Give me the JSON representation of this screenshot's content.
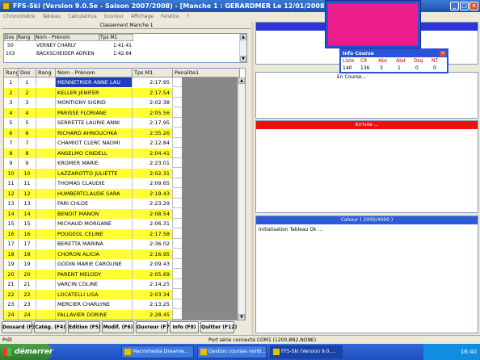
{
  "window": {
    "title": "FFS-Ski (Version 9.0.5e - Saison 2007/2008) - [Manche 1 : GERARDMER Le 12/01/2008 : FOND/KO-QLF]"
  },
  "menu": [
    "Chronométre",
    "Tableau",
    "Calculatrice",
    "Ouvreur",
    "Affichage",
    "Fenêtre",
    "?"
  ],
  "classement": {
    "title": "Classement Manche 1",
    "headers": [
      "Dos",
      "Rang",
      "Nom - Prénom",
      "Tps M1"
    ],
    "rows": [
      {
        "dos": "50",
        "rang": "",
        "nom": "VERNEY CHARLY",
        "tps": "1:41.41"
      },
      {
        "dos": "103",
        "rang": "",
        "nom": "BACKSCHEIDER ADRIEN",
        "tps": "1:42.64"
      }
    ]
  },
  "grid": {
    "headers": [
      "Rang",
      "Dos",
      "Rang",
      "Nom - Prénom",
      "Tps M1",
      "Penalite1"
    ],
    "rows": [
      {
        "rang": "1",
        "dos": "1",
        "nom": "MENNETRIER ANNE LAU",
        "tps": "2:17.95"
      },
      {
        "rang": "2",
        "dos": "2",
        "nom": "KELLER JENIFER",
        "tps": "2:17.54"
      },
      {
        "rang": "3",
        "dos": "3",
        "nom": "MONTIGNY SIGRID",
        "tps": "2:02.38"
      },
      {
        "rang": "4",
        "dos": "4",
        "nom": "PARISSE FLORIANE",
        "tps": "2:05.56"
      },
      {
        "rang": "5",
        "dos": "5",
        "nom": "SERRETTE LAURIE ANNI",
        "tps": "2:17.95"
      },
      {
        "rang": "6",
        "dos": "6",
        "nom": "RICHARD AHNOUCHKA",
        "tps": "2:35.26"
      },
      {
        "rang": "7",
        "dos": "7",
        "nom": "CHAMIOT CLERC NAOMI",
        "tps": "2:12.84"
      },
      {
        "rang": "8",
        "dos": "8",
        "nom": "ANSELMO CINDELL",
        "tps": "2:04.41"
      },
      {
        "rang": "9",
        "dos": "9",
        "nom": "KROMER MARIE",
        "tps": "2:23.01"
      },
      {
        "rang": "10",
        "dos": "10",
        "nom": "LAZZAROTTO JULIETTE",
        "tps": "2:02.31"
      },
      {
        "rang": "11",
        "dos": "11",
        "nom": "THOMAS CLAUDIE",
        "tps": "2:09.65"
      },
      {
        "rang": "12",
        "dos": "12",
        "nom": "HUMBERTCLAUDE SARA",
        "tps": "2:19.43"
      },
      {
        "rang": "13",
        "dos": "13",
        "nom": "FARI CHLOE",
        "tps": "2:23.29"
      },
      {
        "rang": "14",
        "dos": "14",
        "nom": "BENOIT MANON",
        "tps": "2:08.54"
      },
      {
        "rang": "15",
        "dos": "15",
        "nom": "MICHAUD MORGANE",
        "tps": "2:06.31"
      },
      {
        "rang": "16",
        "dos": "16",
        "nom": "POUGEOL CELINE",
        "tps": "2:17.58"
      },
      {
        "rang": "17",
        "dos": "17",
        "nom": "BERETTA MARINA",
        "tps": "2:36.02"
      },
      {
        "rang": "18",
        "dos": "18",
        "nom": "CHORON ALICIA",
        "tps": "2:16.95"
      },
      {
        "rang": "19",
        "dos": "19",
        "nom": "GODIN MARIE CAROLINE",
        "tps": "2:09.43"
      },
      {
        "rang": "20",
        "dos": "20",
        "nom": "PARENT MELODY",
        "tps": "2:05.69"
      },
      {
        "rang": "21",
        "dos": "21",
        "nom": "VARCIN COLINE",
        "tps": "2:14.25"
      },
      {
        "rang": "22",
        "dos": "22",
        "nom": "LOCATELLI LISA",
        "tps": "2:03.34"
      },
      {
        "rang": "23",
        "dos": "23",
        "nom": "MERCIER CHARLYNE",
        "tps": "2:13.25"
      },
      {
        "rang": "24",
        "dos": "24",
        "nom": "FALLAVIER DORINE",
        "tps": "2:28.45"
      }
    ],
    "highlight_color": "#ffff33",
    "selected_color": "#1c3fb8"
  },
  "buttons": [
    "Dossard (F3)",
    "Catég. (F4)",
    "Edition (F5)",
    "Modif. (F6)",
    "Ouvreur (F7)",
    "Info (F8)",
    "Quitter (F12)"
  ],
  "info_course": {
    "title": "Info Course",
    "headers": [
      "Liste",
      "Clt",
      "Abs",
      "Abd",
      "Dsq",
      "NT"
    ],
    "values": [
      "140",
      "136",
      "3",
      "1",
      "0",
      "0"
    ]
  },
  "panels": {
    "en_course": "En Course...",
    "arrivee": "Arrivée ...",
    "cahour": "Cahour ( 2000/4000 )",
    "log": "Initialisation Tableau Ok ..."
  },
  "status": {
    "left": "Prêt",
    "port": "Port série connecté COM1 (1200,8N2,NONE)"
  },
  "taskbar": {
    "start": "démarrer",
    "tasks": [
      "Macromedia Dreamw...",
      "Gestion courses nordi...",
      "FFS-Ski (Version 9.0...."
    ],
    "clock": "16:40"
  },
  "colors": {
    "pink": "#ec1e8c",
    "red": "#ec1010",
    "blue": "#2b35d9"
  }
}
